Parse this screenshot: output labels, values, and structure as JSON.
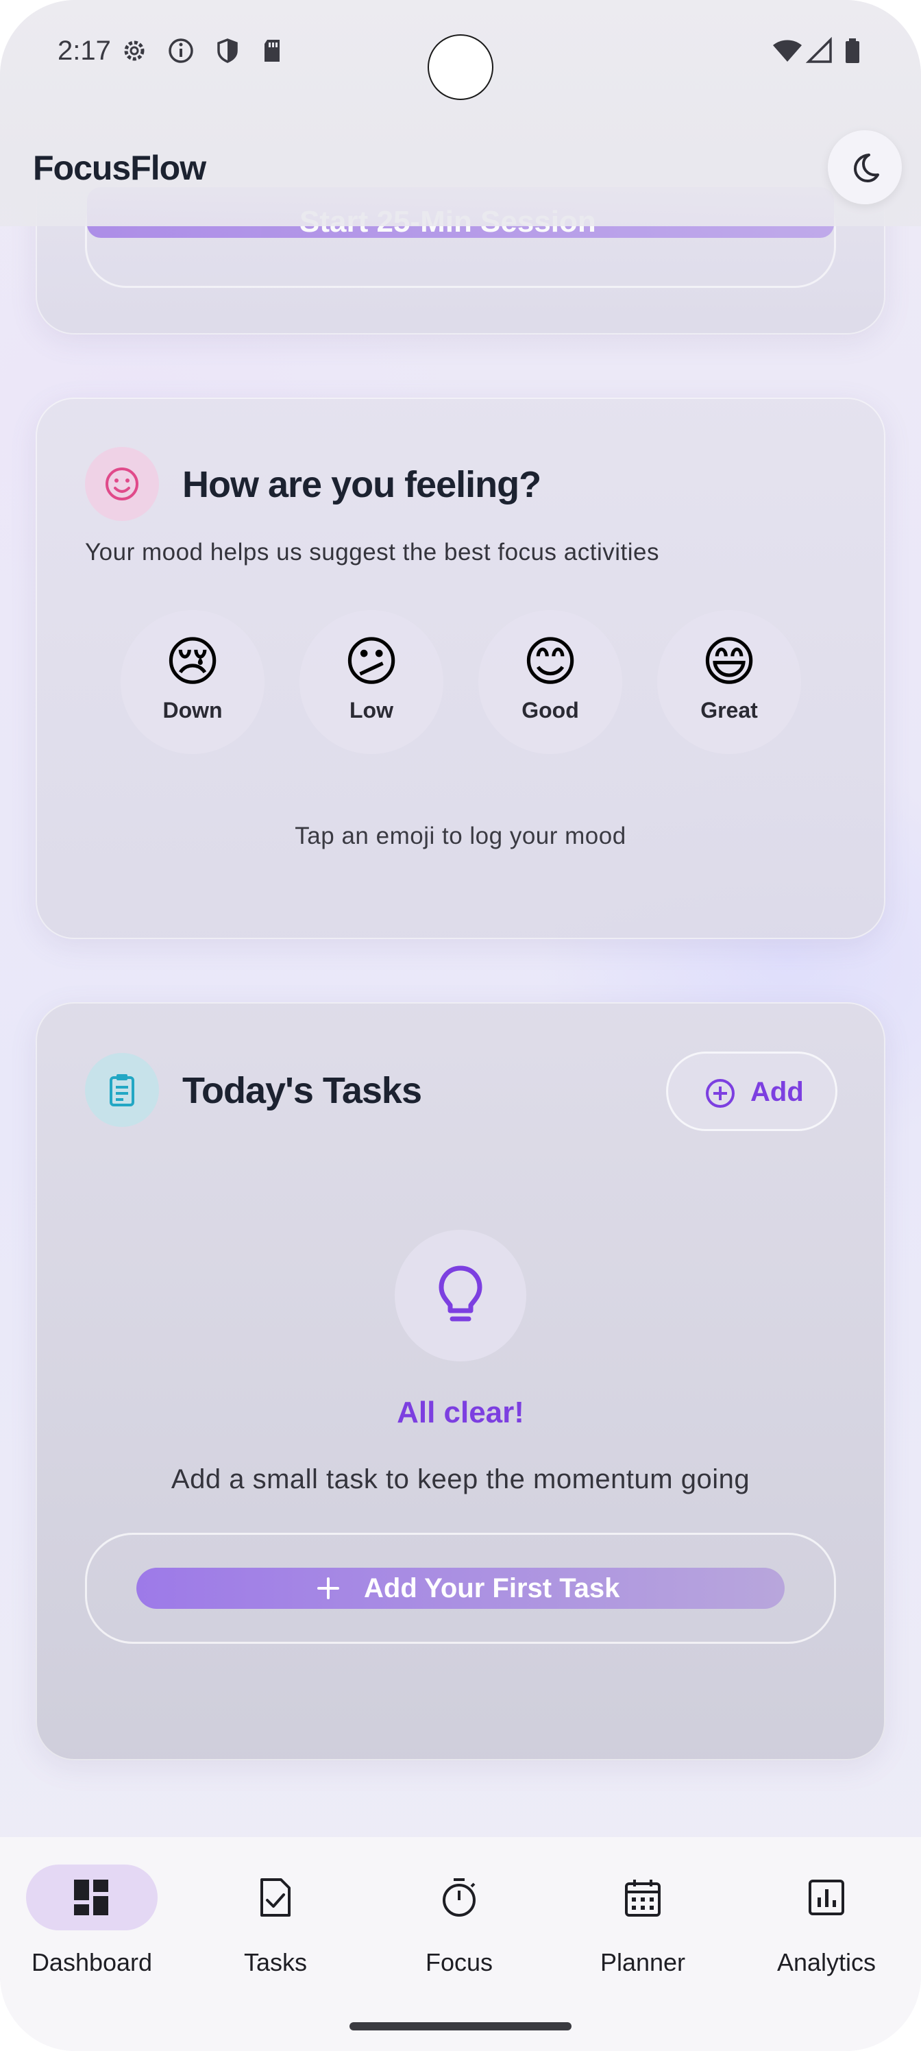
{
  "status_bar": {
    "time": "2:17",
    "icons": [
      "settings-icon",
      "info-icon",
      "shield-icon",
      "sd-card-icon",
      "wifi-icon",
      "signal-icon",
      "battery-icon"
    ]
  },
  "app_bar": {
    "title": "FocusFlow",
    "theme_toggle_icon": "moon-icon"
  },
  "session_card": {
    "button_label": "Start 25-Min Session"
  },
  "mood_card": {
    "title": "How are you feeling?",
    "subtitle": "Your mood helps us suggest the best focus activities",
    "options": [
      {
        "emoji": "😢",
        "label": "Down"
      },
      {
        "emoji": "😕",
        "label": "Low"
      },
      {
        "emoji": "😊",
        "label": "Good"
      },
      {
        "emoji": "😄",
        "label": "Great"
      }
    ],
    "hint": "Tap an emoji to log your mood",
    "icon_color": "#e04a8a"
  },
  "tasks_card": {
    "title": "Today's Tasks",
    "add_label": "Add",
    "empty_title": "All clear!",
    "empty_text": "Add a small task to keep the momentum going",
    "first_task_label": "Add Your First Task",
    "icon_color": "#22a7c4",
    "accent_color": "#7c3fe0"
  },
  "bottom_nav": {
    "items": [
      {
        "label": "Dashboard",
        "icon": "dashboard-icon",
        "active": true
      },
      {
        "label": "Tasks",
        "icon": "task-check-icon",
        "active": false
      },
      {
        "label": "Focus",
        "icon": "timer-icon",
        "active": false
      },
      {
        "label": "Planner",
        "icon": "calendar-icon",
        "active": false
      },
      {
        "label": "Analytics",
        "icon": "analytics-icon",
        "active": false
      }
    ]
  }
}
